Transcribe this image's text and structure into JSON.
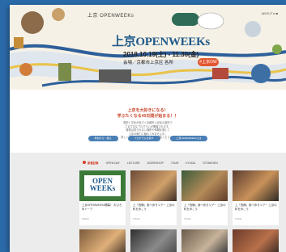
{
  "hero": {
    "small_title": "上京 OPENWEEKs",
    "title": "上京OPENWEEKs",
    "date": "2018.10.19(土) - 11.30(金)",
    "place": "会場／京都市上京区 各所",
    "badge": "#上京OW",
    "nav": "ABOUT ▸ ■"
  },
  "intro": {
    "headline_1": "上京を大好きになる！",
    "headline_2": "学ぶたくなる40日間が始まる！！",
    "body": [
      "歴史と文化が息づく京都市上京区の各所で",
      "さまざまなプログラムが開催されます。",
      "普段は見られない場所や体験を通して",
      "上京の魅力に触れてみませんか。",
      "詳しくは各プログラムページをご覧ください。"
    ],
    "buttons": [
      "参加する・観る",
      "プログラムを探す",
      "上京OPENWEEKsとは"
    ]
  },
  "tabs": {
    "items": [
      "新着記事",
      "OPEN DAY",
      "LECTURE",
      "WORKSHOP",
      "TOUR",
      "KYODA",
      "OTOMIGEN"
    ]
  },
  "cards": [
    {
      "text": "上京OPENWEEKs開幕！ おひろめトーク",
      "tag": "OPEN"
    },
    {
      "text": "上「西陣」食べ歩きツアー 上京の町を歩こう",
      "tag": "TOUR"
    },
    {
      "text": "上「西陣」食べ歩きツアー 上京の町を歩こう",
      "tag": "TOUR"
    },
    {
      "text": "上「西陣」食べ歩きツアー 上京の町を歩こう",
      "tag": "TOUR"
    }
  ]
}
